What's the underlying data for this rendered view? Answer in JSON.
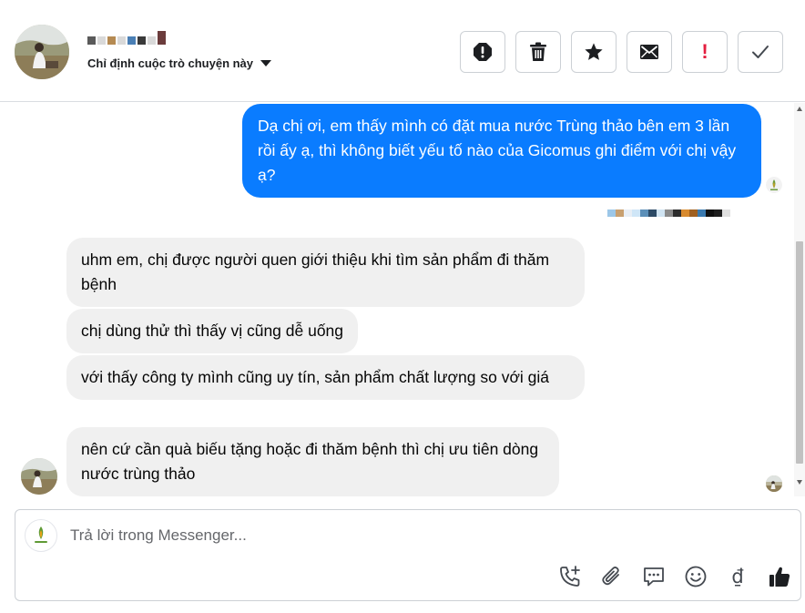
{
  "header": {
    "assign_label": "Chỉ định cuộc trò chuyện này",
    "name_pixel_colors": [
      "#5a5a5a",
      "#d9d9d9",
      "#b58a52",
      "#d9d9d9",
      "#4a7fb5",
      "#3a3a3a",
      "#d9d9d9",
      "#6b3c3c"
    ],
    "actions": [
      {
        "icon": "alert-circle-icon"
      },
      {
        "icon": "trash-icon"
      },
      {
        "icon": "star-icon"
      },
      {
        "icon": "envelope-icon"
      },
      {
        "icon": "exclamation-icon",
        "glyph": "!"
      },
      {
        "icon": "check-icon"
      }
    ]
  },
  "messages": {
    "outgoing": [
      {
        "text": "Dạ chị ơi, em thấy mình có đặt mua nước Trùng thảo bên em 3 lần rồi ấy ạ, thì không biết yếu tố nào của Gicomus ghi điểm với chị vậy ạ?"
      }
    ],
    "sender_pixel_colors": [
      "#9cc7e8",
      "#c8a070",
      "#e8eef5",
      "#cfe6f7",
      "#5b8fb8",
      "#2c4a66",
      "#d0e4f2",
      "#8a8a8a",
      "#2d2d2d",
      "#d88a2e",
      "#a06020",
      "#3a7ab0",
      "#101010",
      "#1e1e1e",
      "#e0e0e0"
    ],
    "incoming": [
      {
        "text": "uhm em, chị được người quen giới thiệu khi tìm sản phẩm đi thăm bệnh"
      },
      {
        "text": "chị dùng thử thì thấy vị cũng dễ uống"
      },
      {
        "text": "với thấy công ty mình cũng uy tín, sản phẩm chất lượng so với giá"
      },
      {
        "text": "nên cứ cần quà biếu tặng hoặc đi thăm bệnh thì chị ưu tiên dòng nước trùng thảo"
      }
    ]
  },
  "composer": {
    "placeholder": "Trả lời trong Messenger...",
    "tools": [
      {
        "icon": "call-plus-icon"
      },
      {
        "icon": "paperclip-icon"
      },
      {
        "icon": "saved-replies-icon"
      },
      {
        "icon": "emoji-icon"
      },
      {
        "icon": "dong-currency-icon",
        "glyph": "₫"
      },
      {
        "icon": "thumbs-up-icon"
      }
    ]
  },
  "colors": {
    "outgoing_bubble": "#0a7cff",
    "incoming_bubble": "#f0f0f0",
    "alert_red": "#e41e3f"
  }
}
